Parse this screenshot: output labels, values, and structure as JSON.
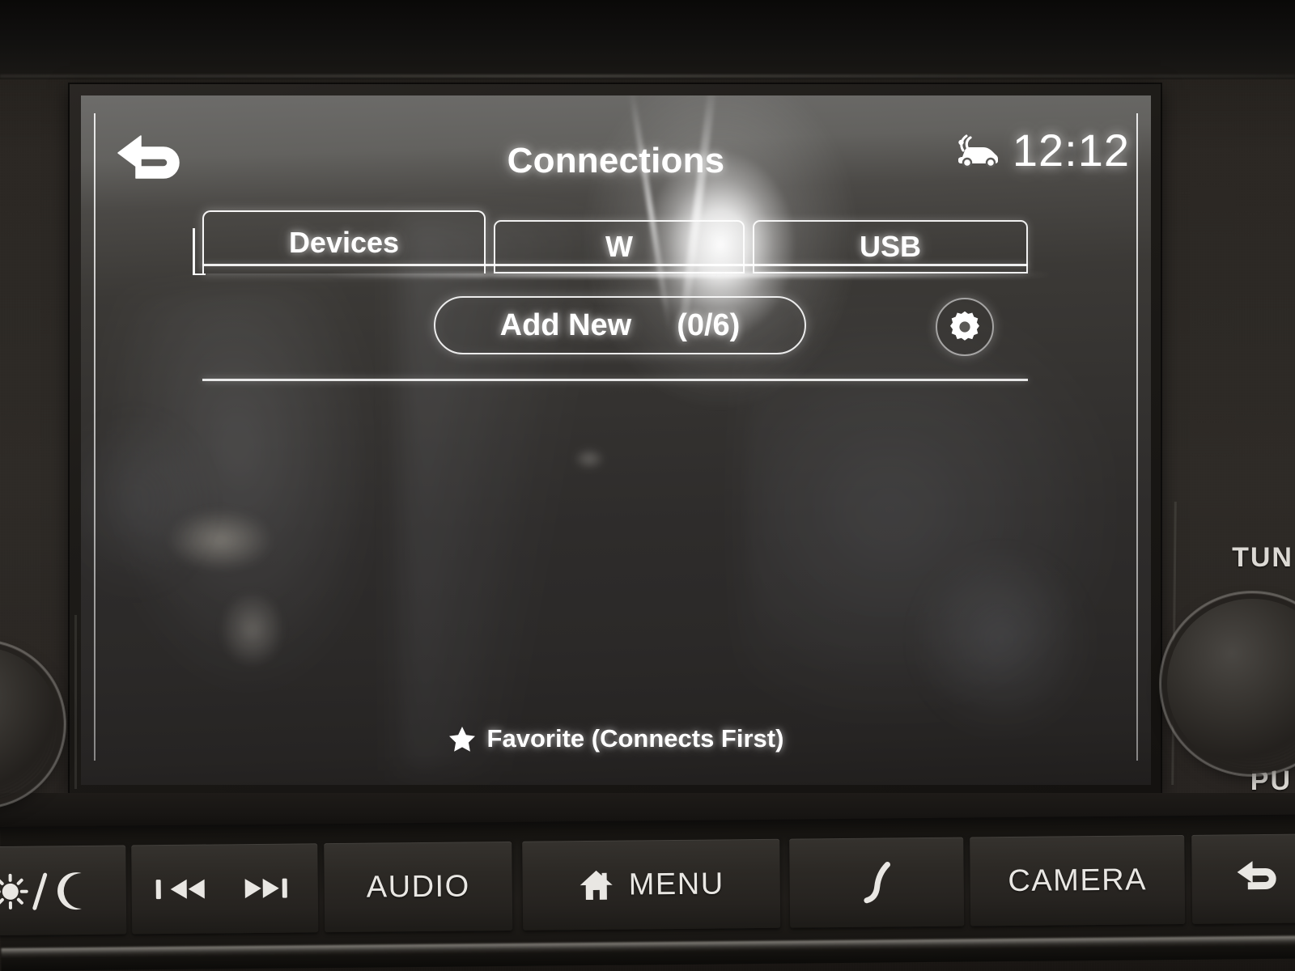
{
  "screen": {
    "header": {
      "back_icon": "back-arrow-icon",
      "title": "Connections",
      "connected_car_icon": "connected-car-icon",
      "clock": "12:12"
    },
    "tabs": [
      {
        "label": "Devices",
        "selected": true,
        "name": "tab-devices"
      },
      {
        "label": "W",
        "selected": false,
        "name": "tab-wifi",
        "note": "obscured-by-glare"
      },
      {
        "label": "USB",
        "selected": false,
        "name": "tab-usb"
      }
    ],
    "toolbar": {
      "add_new_label": "Add New",
      "add_new_count": "(0/6)",
      "settings_icon": "gear-icon"
    },
    "device_list": {
      "items": []
    },
    "legend": {
      "star_icon": "star-icon",
      "text": "Favorite (Connects First)"
    }
  },
  "hardware": {
    "keys": [
      {
        "name": "key-day-night",
        "label": "",
        "icon": "sun-moon-icon"
      },
      {
        "name": "key-prev-next",
        "label": "",
        "icon": "prev-next-icon"
      },
      {
        "name": "key-audio",
        "label": "AUDIO",
        "icon": ""
      },
      {
        "name": "key-menu",
        "label": "MENU",
        "icon": "home-icon"
      },
      {
        "name": "key-phone",
        "label": "",
        "icon": "phone-icon"
      },
      {
        "name": "key-camera",
        "label": "CAMERA",
        "icon": ""
      },
      {
        "name": "key-back",
        "label": "",
        "icon": "back-arrow-icon"
      }
    ],
    "right_knob": {
      "top_label": "TUN",
      "bottom_label": "PU"
    }
  },
  "colors": {
    "ui_white": "#ffffff",
    "screen_bg": "#343230",
    "panel": "#262320",
    "key_text": "#e9e7e3"
  }
}
